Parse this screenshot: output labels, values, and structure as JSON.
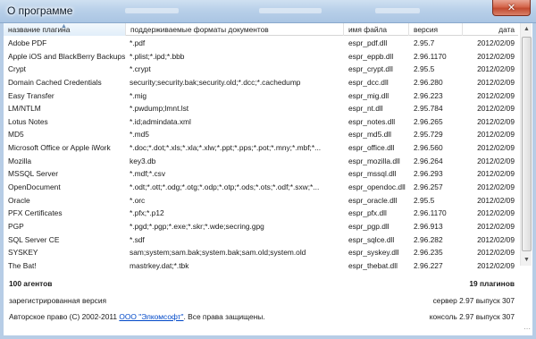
{
  "window": {
    "title": "О программе",
    "close_glyph": "✕",
    "close_icon": "close-icon"
  },
  "columns": {
    "name": "название плагина",
    "formats": "поддерживаемые форматы документов",
    "file": "имя файла",
    "version": "версия",
    "date": "дата"
  },
  "plugins": [
    {
      "name": "Adobe PDF",
      "formats": "*.pdf",
      "file": "espr_pdf.dll",
      "version": "2.95.7",
      "date": "2012/02/09"
    },
    {
      "name": "Apple iOS and BlackBerry Backups",
      "formats": "*.plist;*.ipd;*.bbb",
      "file": "espr_eppb.dll",
      "version": "2.96.1170",
      "date": "2012/02/09"
    },
    {
      "name": "Crypt",
      "formats": "*.crypt",
      "file": "espr_crypt.dll",
      "version": "2.95.5",
      "date": "2012/02/09"
    },
    {
      "name": "Domain Cached Credentials",
      "formats": "security;security.bak;security.old;*.dcc;*.cachedump",
      "file": "espr_dcc.dll",
      "version": "2.96.280",
      "date": "2012/02/09"
    },
    {
      "name": "Easy Transfer",
      "formats": "*.mig",
      "file": "espr_mig.dll",
      "version": "2.96.223",
      "date": "2012/02/09"
    },
    {
      "name": "LM/NTLM",
      "formats": "*.pwdump;lmnt.lst",
      "file": "espr_nt.dll",
      "version": "2.95.784",
      "date": "2012/02/09"
    },
    {
      "name": "Lotus Notes",
      "formats": "*.id;admindata.xml",
      "file": "espr_notes.dll",
      "version": "2.96.265",
      "date": "2012/02/09"
    },
    {
      "name": "MD5",
      "formats": "*.md5",
      "file": "espr_md5.dll",
      "version": "2.95.729",
      "date": "2012/02/09"
    },
    {
      "name": "Microsoft Office or Apple iWork",
      "formats": "*.doc;*.dot;*.xls;*.xla;*.xlw;*.ppt;*.pps;*.pot;*.mny;*.mbf;*...",
      "file": "espr_office.dll",
      "version": "2.96.560",
      "date": "2012/02/09"
    },
    {
      "name": "Mozilla",
      "formats": "key3.db",
      "file": "espr_mozilla.dll",
      "version": "2.96.264",
      "date": "2012/02/09"
    },
    {
      "name": "MSSQL Server",
      "formats": "*.mdf;*.csv",
      "file": "espr_mssql.dll",
      "version": "2.96.293",
      "date": "2012/02/09"
    },
    {
      "name": "OpenDocument",
      "formats": "*.odt;*.ott;*.odg;*.otg;*.odp;*.otp;*.ods;*.ots;*.odf;*.sxw;*...",
      "file": "espr_opendoc.dll",
      "version": "2.96.257",
      "date": "2012/02/09"
    },
    {
      "name": "Oracle",
      "formats": "*.orc",
      "file": "espr_oracle.dll",
      "version": "2.95.5",
      "date": "2012/02/09"
    },
    {
      "name": "PFX Certificates",
      "formats": "*.pfx;*.p12",
      "file": "espr_pfx.dll",
      "version": "2.96.1170",
      "date": "2012/02/09"
    },
    {
      "name": "PGP",
      "formats": "*.pgd;*.pgp;*.exe;*.skr;*.wde;secring.gpg",
      "file": "espr_pgp.dll",
      "version": "2.96.913",
      "date": "2012/02/09"
    },
    {
      "name": "SQL Server CE",
      "formats": "*.sdf",
      "file": "espr_sqlce.dll",
      "version": "2.96.282",
      "date": "2012/02/09"
    },
    {
      "name": "SYSKEY",
      "formats": "sam;system;sam.bak;system.bak;sam.old;system.old",
      "file": "espr_syskey.dll",
      "version": "2.96.235",
      "date": "2012/02/09"
    },
    {
      "name": "The Bat!",
      "formats": "mastrkey.dat;*.tbk",
      "file": "espr_thebat.dll",
      "version": "2.96.227",
      "date": "2012/02/09"
    }
  ],
  "summary": {
    "agents": "100 агентов",
    "plugins": "19 плагинов"
  },
  "footer": {
    "registration": "зарегистрированная версия",
    "server": "сервер 2.97  выпуск 307",
    "copyright_prefix": "Авторское право (C) 2002-2011",
    "company_link": "ООО \"Элкомсофт\"",
    "copyright_suffix": ". Все права защищены.",
    "console": "консоль 2.97  выпуск 307"
  },
  "colors": {
    "link": "#0048c8",
    "titlebar": "#b9d0e9",
    "close_button": "#c7502f"
  }
}
